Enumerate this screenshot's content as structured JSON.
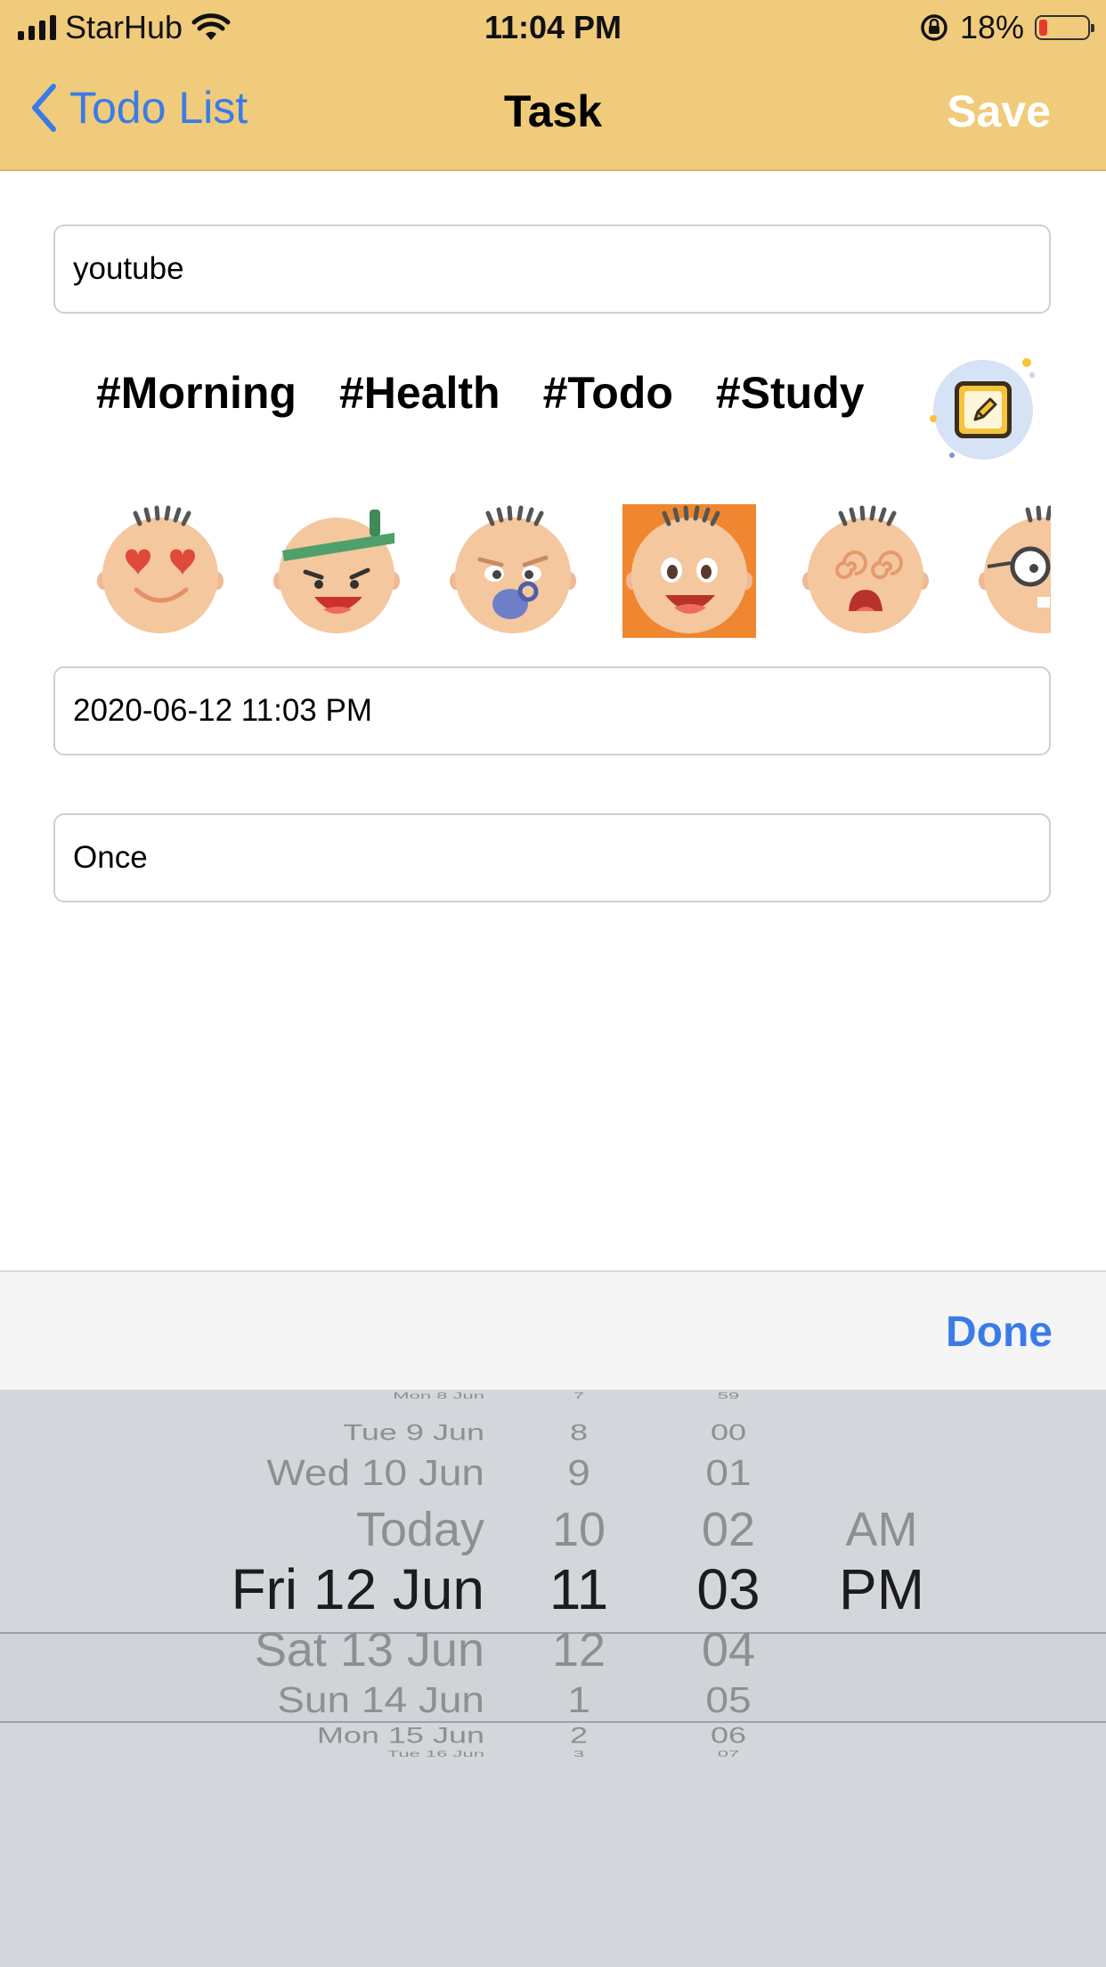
{
  "status_bar": {
    "carrier": "StarHub",
    "time": "11:04 PM",
    "battery_percent": "18%",
    "battery_level": 0.18
  },
  "nav": {
    "back_label": "Todo List",
    "title": "Task",
    "save_label": "Save"
  },
  "task": {
    "name_value": "youtube",
    "datetime_value": "2020-06-12 11:03 PM",
    "repeat_value": "Once"
  },
  "tags": [
    "#Morning",
    "#Health",
    "#Todo",
    "#Study"
  ],
  "emoji_icons": [
    "heart-eyes-face-icon",
    "headband-face-icon",
    "pacifier-face-icon",
    "happy-face-icon",
    "dizzy-face-icon",
    "glasses-face-icon"
  ],
  "selected_emoji_index": 3,
  "toolbar": {
    "done_label": "Done"
  },
  "picker": {
    "dates": [
      "Mon 8 Jun",
      "Tue 9 Jun",
      "Wed 10 Jun",
      "Today",
      "Fri 12 Jun",
      "Sat 13 Jun",
      "Sun 14 Jun",
      "Mon 15 Jun",
      "Tue 16 Jun"
    ],
    "hours": [
      "7",
      "8",
      "9",
      "10",
      "11",
      "12",
      "1",
      "2",
      "3"
    ],
    "minutes": [
      "59",
      "00",
      "01",
      "02",
      "03",
      "04",
      "05",
      "06",
      "07"
    ],
    "meridiem": [
      "AM",
      "PM"
    ],
    "selected_date": "Fri 12 Jun",
    "selected_hour": "11",
    "selected_minute": "03",
    "selected_meridiem": "PM"
  },
  "colors": {
    "nav_background": "#f0cb7b",
    "accent_blue": "#3a7be8",
    "selected_emoji_bg": "#f0862f",
    "picker_background": "#d3d6db"
  }
}
